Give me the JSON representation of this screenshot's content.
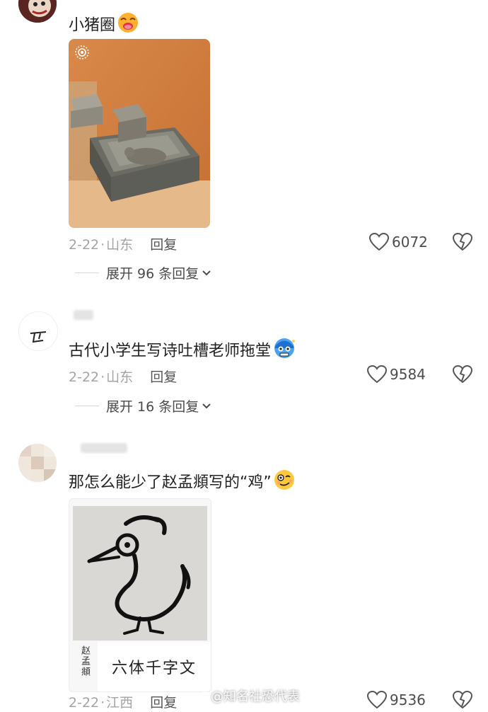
{
  "comments": [
    {
      "text": "小猪圈",
      "emoji": "pig-face-emoji",
      "date": "2-22",
      "region": "山东",
      "reply_label": "回复",
      "likes": "6072",
      "expand_label": "展开 96 条回复"
    },
    {
      "text": "古代小学生写诗吐槽老师拖堂",
      "emoji": "frozen-face-emoji",
      "date": "2-22",
      "region": "山东",
      "reply_label": "回复",
      "likes": "9584",
      "expand_label": "展开 16 条回复"
    },
    {
      "text": "那怎么能少了赵孟頫写的“鸡”",
      "emoji": "woozy-face-emoji",
      "date": "2-22",
      "region": "江西",
      "reply_label": "回复",
      "likes": "9536"
    }
  ],
  "calligraphy": {
    "author": "赵孟頫",
    "title": "六体千字文"
  },
  "watermark": {
    "text": "@知名社恐代表"
  },
  "colors": {
    "meta": "#a3a3a3",
    "text": "#222222",
    "accent_heart": "#555555"
  }
}
